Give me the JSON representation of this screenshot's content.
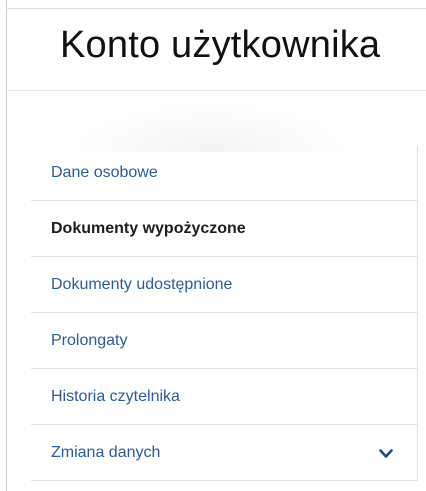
{
  "header": {
    "title": "Konto użytkownika"
  },
  "nav": {
    "items": [
      {
        "label": "Dane osobowe",
        "active": false
      },
      {
        "label": "Dokumenty wypożyczone",
        "active": true
      },
      {
        "label": "Dokumenty udostępnione",
        "active": false
      },
      {
        "label": "Prolongaty",
        "active": false
      },
      {
        "label": "Historia czytelnika",
        "active": false
      },
      {
        "label": "Zmiana danych",
        "active": false,
        "icon": "chevron-down-icon"
      }
    ]
  },
  "colors": {
    "link": "#2a5b9c",
    "active": "#1d1d1d",
    "chevron": "#1e4f86"
  }
}
